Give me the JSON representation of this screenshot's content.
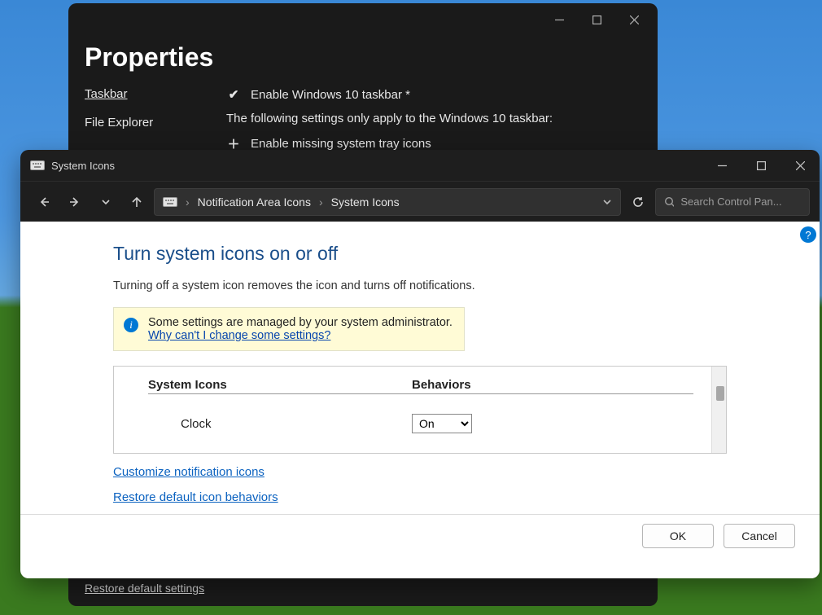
{
  "properties_window": {
    "title": "Properties",
    "nav": {
      "taskbar": "Taskbar",
      "file_explorer": "File Explorer"
    },
    "rows": {
      "enable_taskbar": "Enable Windows 10 taskbar *",
      "note": "The following settings only apply to the Windows 10 taskbar:",
      "enable_tray": "Enable missing system tray icons"
    },
    "footer_link": "Restore default settings"
  },
  "cp_window": {
    "title": "System Icons",
    "breadcrumb": {
      "level1": "Notification Area Icons",
      "level2": "System Icons"
    },
    "search_placeholder": "Search Control Pan...",
    "heading": "Turn system icons on or off",
    "description": "Turning off a system icon removes the icon and turns off notifications.",
    "infobox": {
      "line1": "Some settings are managed by your system administrator.",
      "link": "Why can't I change some settings?"
    },
    "table": {
      "col_icons": "System Icons",
      "col_behaviors": "Behaviors",
      "rows": [
        {
          "name": "Clock",
          "value": "On"
        }
      ]
    },
    "links": {
      "customize": "Customize notification icons",
      "restore": "Restore default icon behaviors"
    },
    "buttons": {
      "ok": "OK",
      "cancel": "Cancel"
    }
  }
}
